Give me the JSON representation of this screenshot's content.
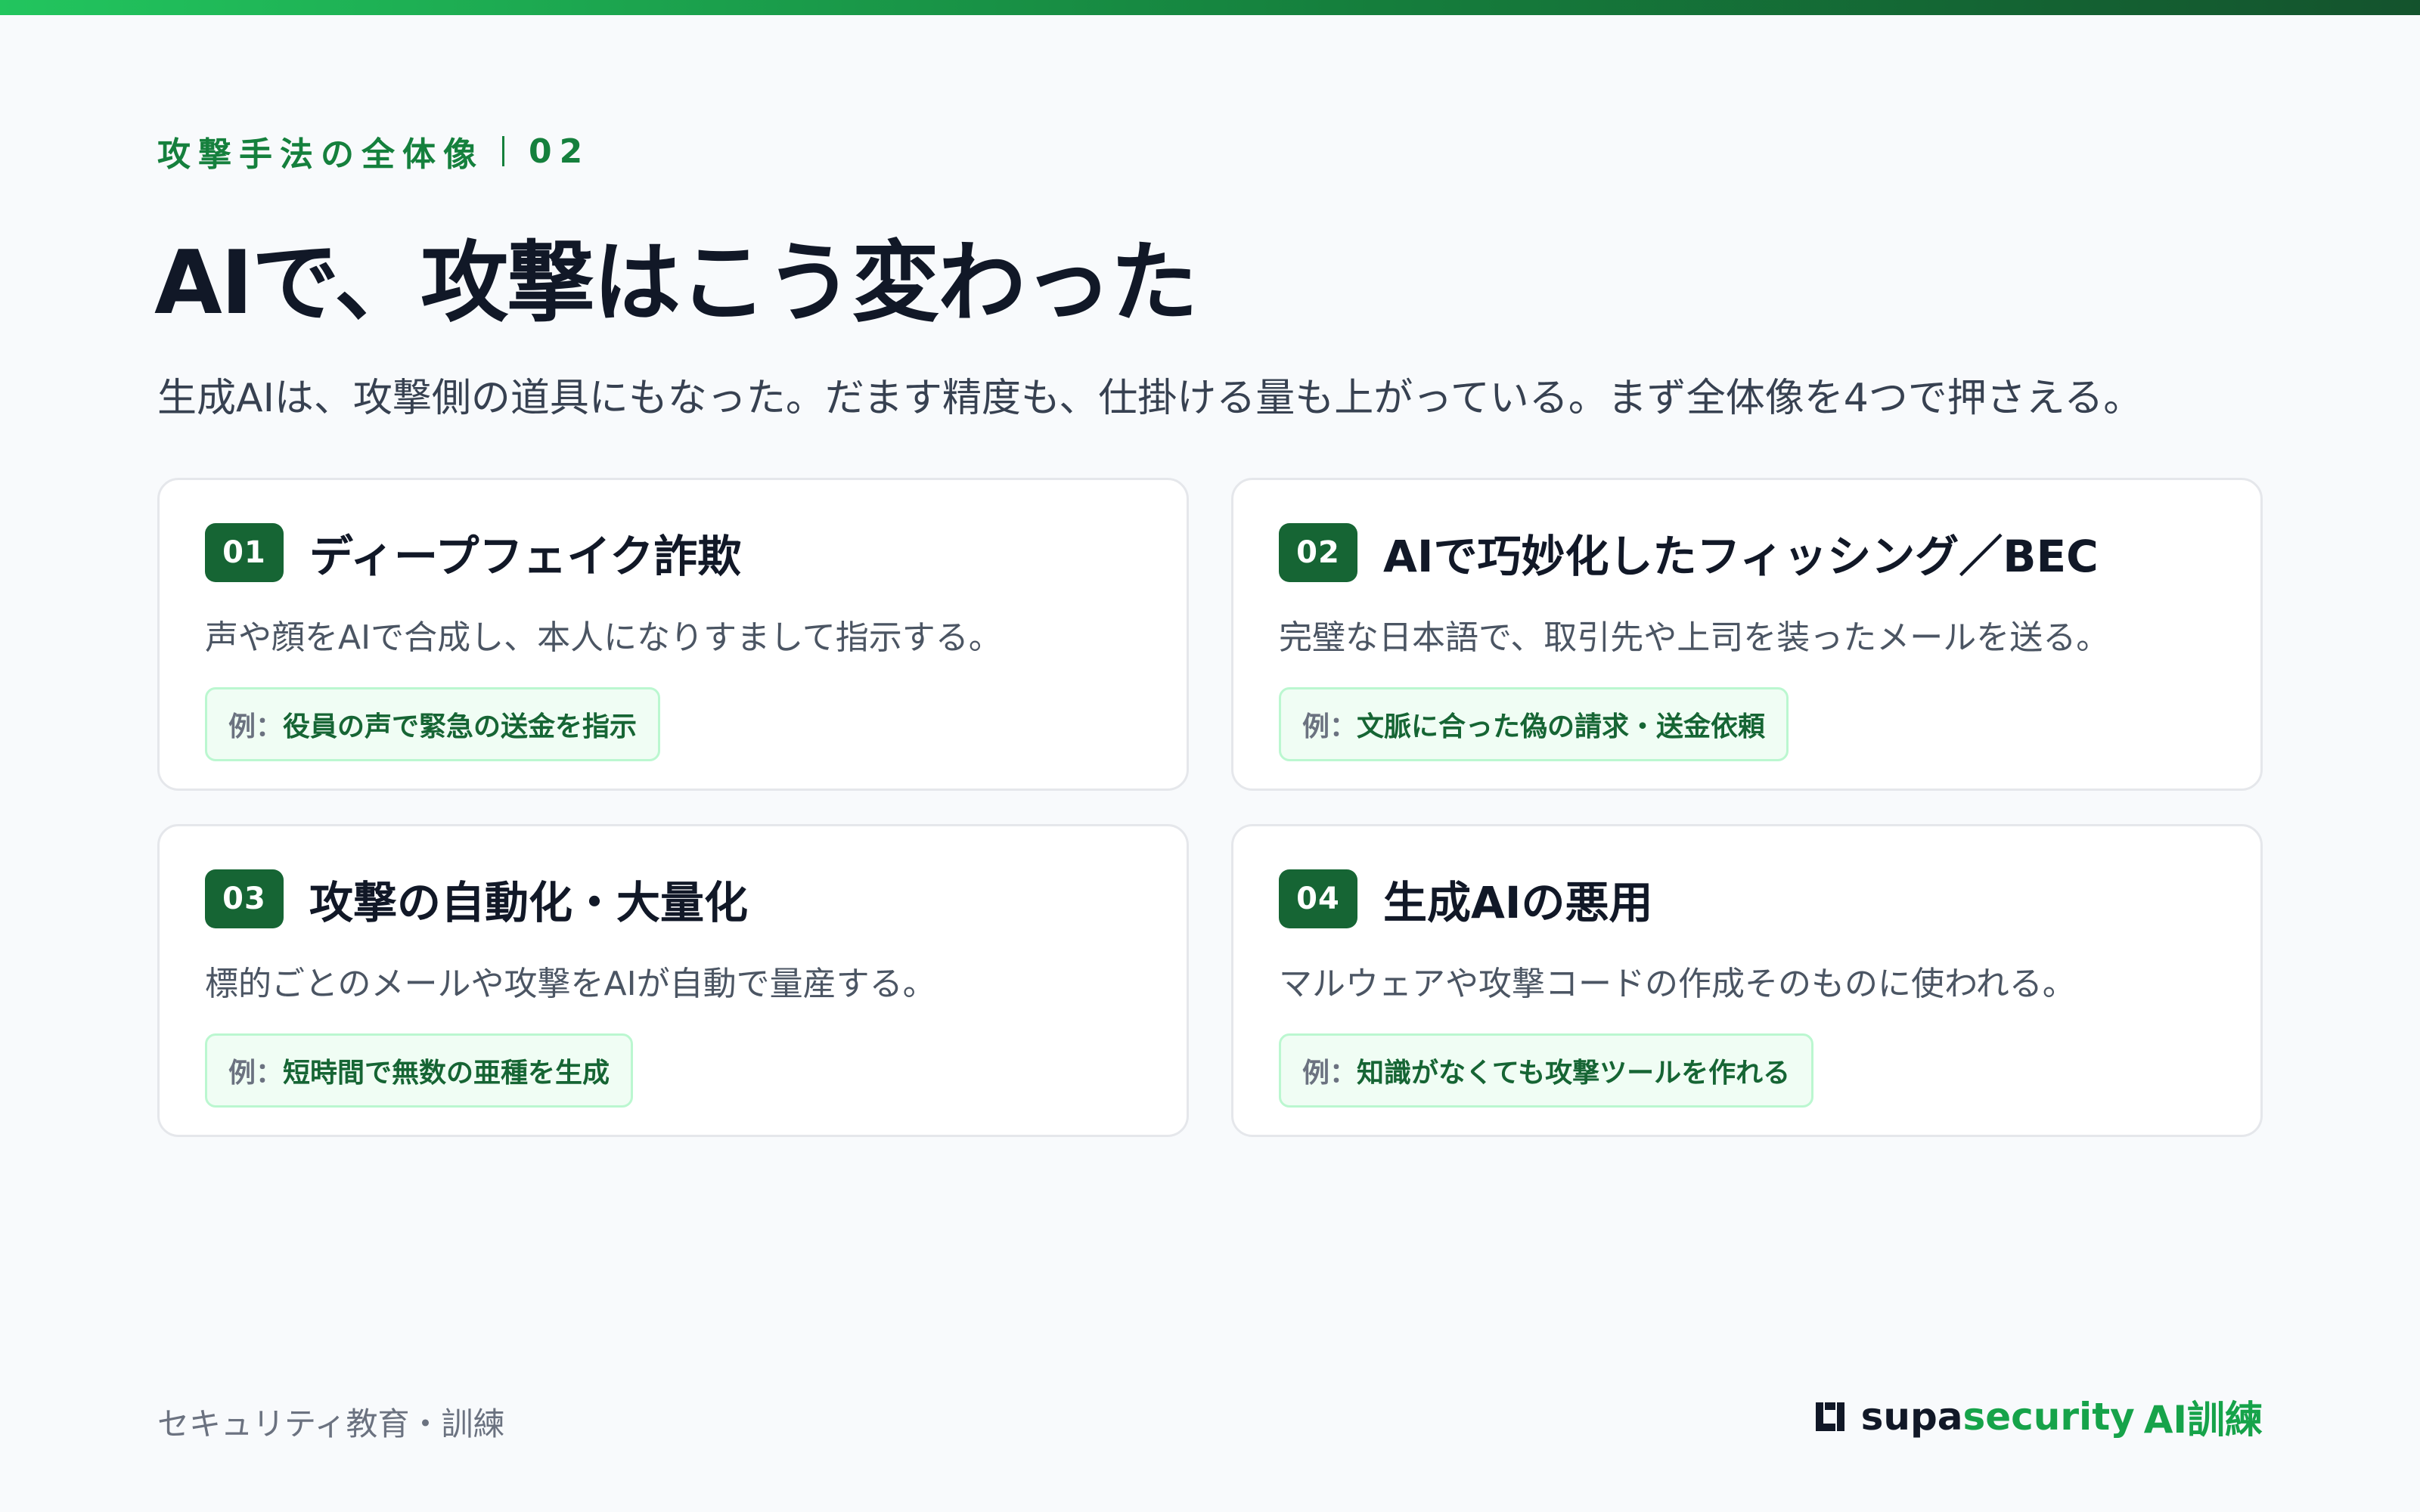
{
  "header": {
    "eyebrow_label": "攻撃手法の全体像",
    "eyebrow_number": "02",
    "title": "AIで、攻撃はこう変わった",
    "lead": "生成AIは、攻撃側の道具にもなった。だます精度も、仕掛ける量も上がっている。まず全体像を4つで押さえる。"
  },
  "cards": [
    {
      "number": "01",
      "title": "ディープフェイク詐欺",
      "description": "声や顔をAIで合成し、本人になりすまして指示する。",
      "example_prefix": "例：",
      "example": "役員の声で緊急の送金を指示"
    },
    {
      "number": "02",
      "title": "AIで巧妙化したフィッシング／BEC",
      "description": "完璧な日本語で、取引先や上司を装ったメールを送る。",
      "example_prefix": "例：",
      "example": "文脈に合った偽の請求・送金依頼"
    },
    {
      "number": "03",
      "title": "攻撃の自動化・大量化",
      "description": "標的ごとのメールや攻撃をAIが自動で量産する。",
      "example_prefix": "例：",
      "example": "短時間で無数の亜種を生成"
    },
    {
      "number": "04",
      "title": "生成AIの悪用",
      "description": "マルウェアや攻撃コードの作成そのものに使われる。",
      "example_prefix": "例：",
      "example": "知識がなくても攻撃ツールを作れる"
    }
  ],
  "footer": {
    "left_text": "セキュリティ教育・訓練",
    "brand_part1": "supa",
    "brand_part2": "security",
    "brand_part3": "AI訓練",
    "logo_icon": "bracket-square-icon"
  },
  "colors": {
    "accent": "#15803d",
    "badge": "#166534",
    "example_bg": "#f0fdf4",
    "example_border": "#bbf7d0"
  }
}
